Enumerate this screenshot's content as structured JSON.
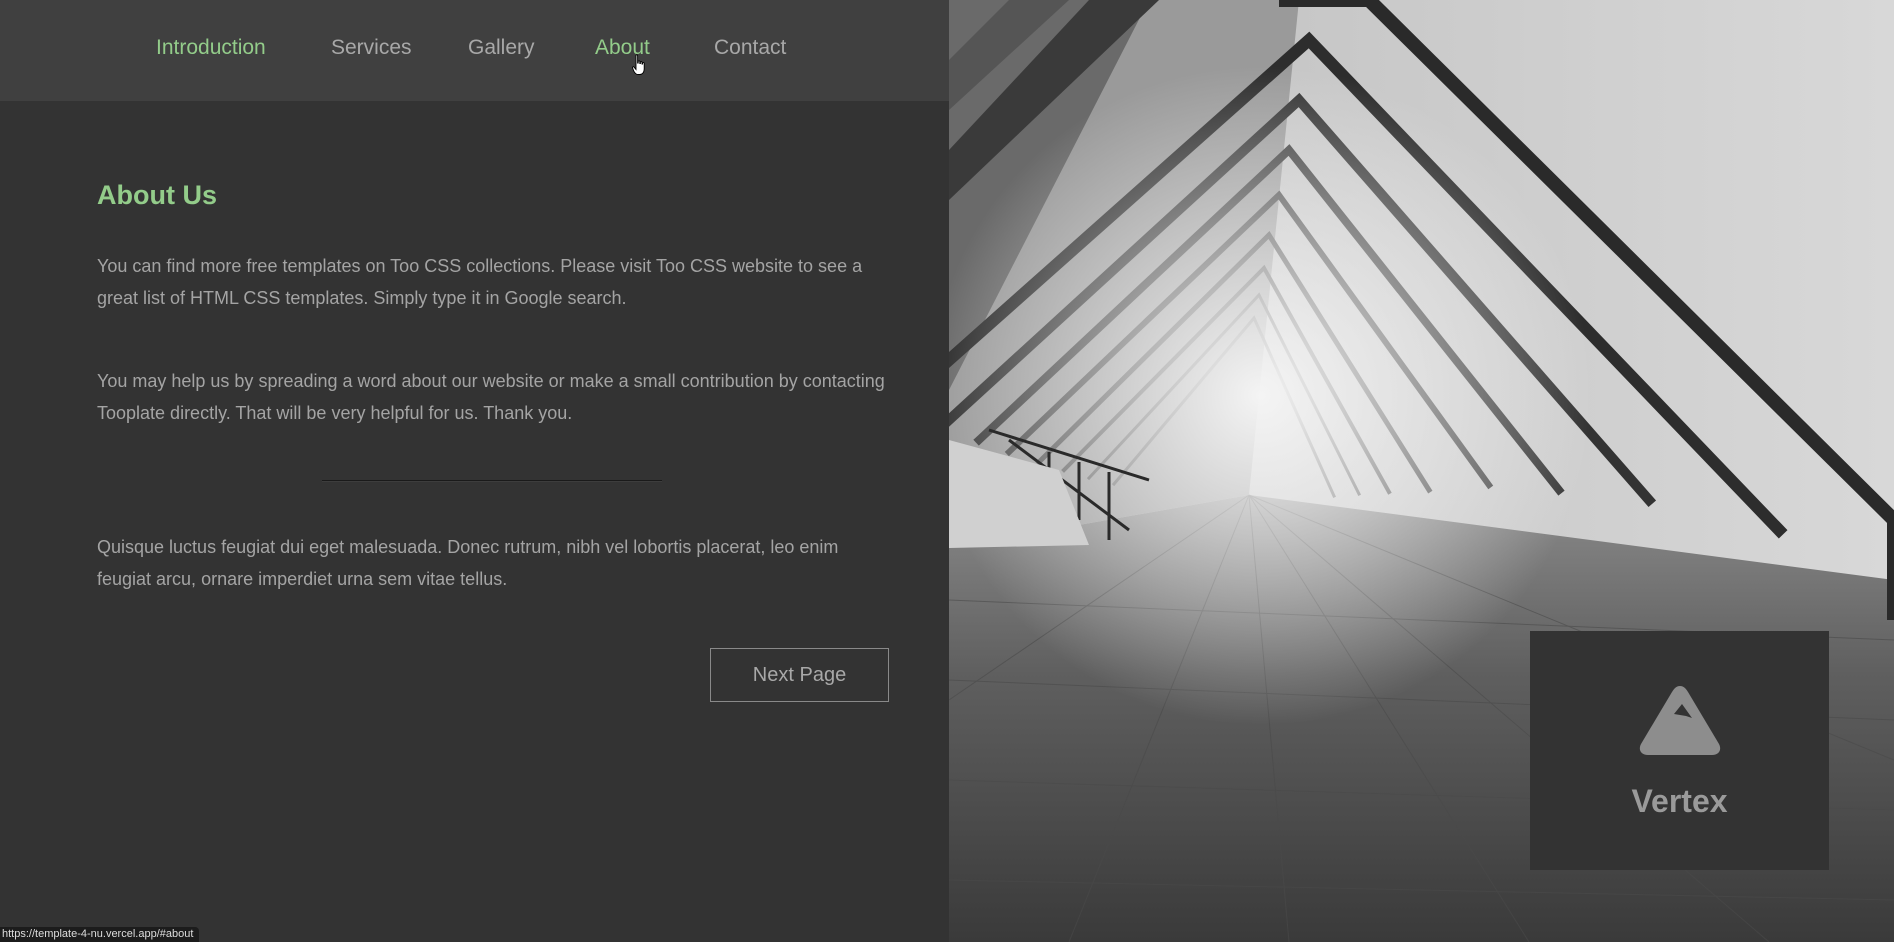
{
  "nav": {
    "items": [
      {
        "label": "Introduction",
        "state": "active"
      },
      {
        "label": "Services",
        "state": "normal"
      },
      {
        "label": "Gallery",
        "state": "normal"
      },
      {
        "label": "About",
        "state": "hover"
      },
      {
        "label": "Contact",
        "state": "normal"
      }
    ]
  },
  "about": {
    "title": "About Us",
    "paragraph1": "You can find more free templates on Too CSS collections. Please visit Too CSS website to see a great list of HTML CSS templates. Simply type it in Google search.",
    "paragraph2": "You may help us by spreading a word about our website or make a small contribution by contacting Tooplate directly. That will be very helpful for us. Thank you.",
    "paragraph3": "Quisque luctus feugiat dui eget malesuada. Donec rutrum, nibh vel lobortis placerat, leo enim feugiat arcu, ornare imperdiet urna sem vitae tellus.",
    "next_button": "Next Page"
  },
  "brand": {
    "name": "Vertex",
    "icon": "mountain-triangle-icon"
  },
  "status_bar": {
    "url": "https://template-4-nu.vercel.app/#about"
  },
  "colors": {
    "accent": "#93cc8a",
    "panel_bg": "#333333",
    "nav_bg": "#404040",
    "text": "#a4a4a4"
  }
}
